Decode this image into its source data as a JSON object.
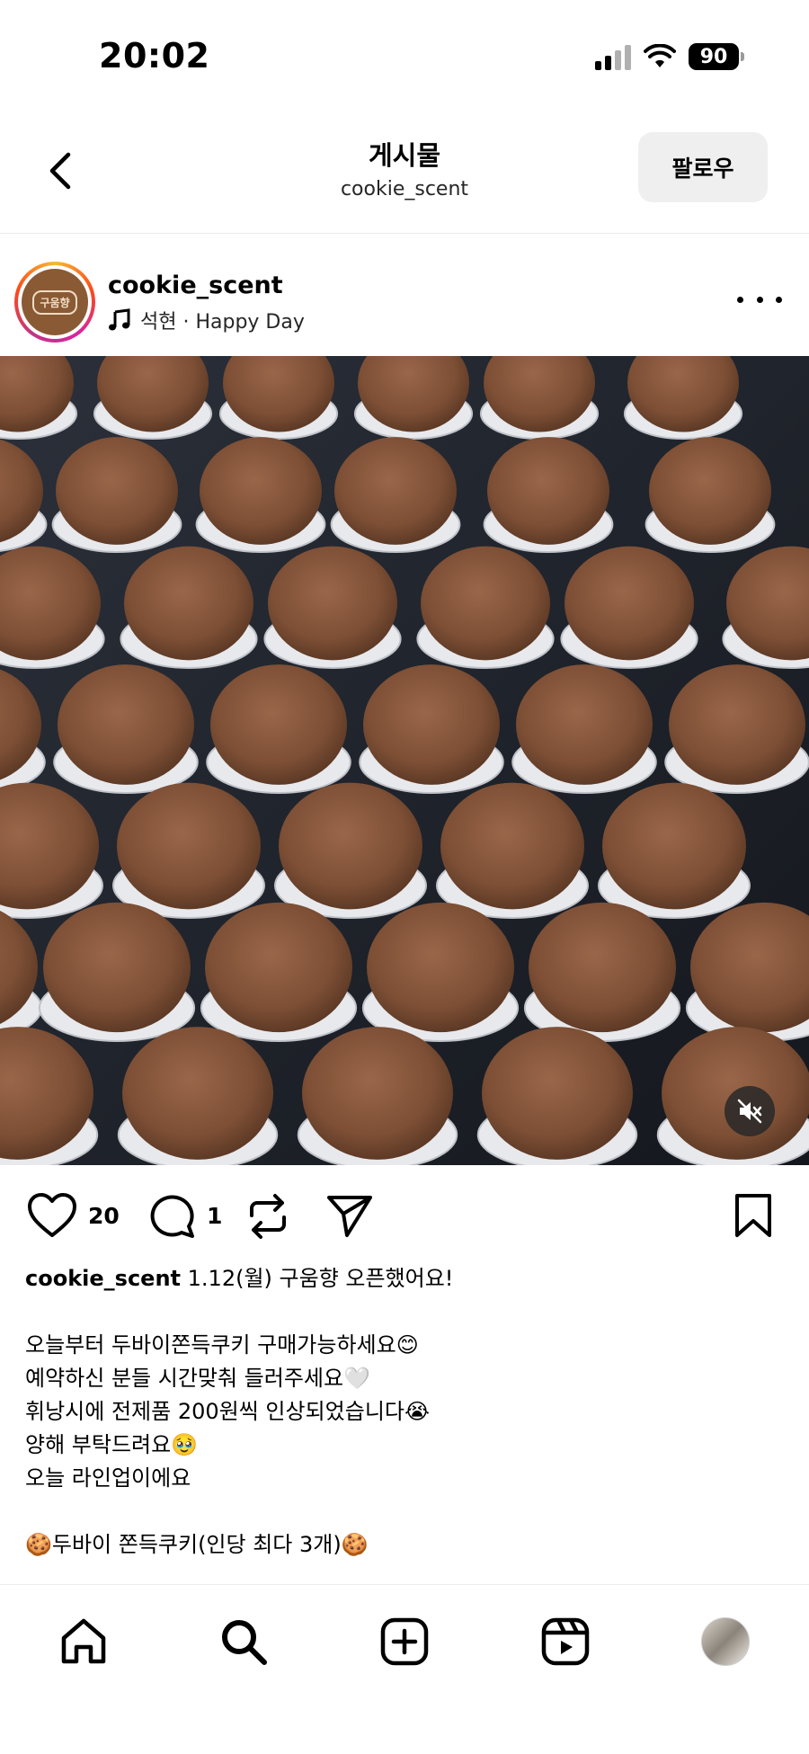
{
  "status_bar": {
    "time": "20:02",
    "battery": "90"
  },
  "header": {
    "title": "게시물",
    "subtitle": "cookie_scent",
    "follow_label": "팔로우"
  },
  "post": {
    "username": "cookie_scent",
    "avatar_text": "구움향",
    "music": "석현 · Happy Day",
    "likes": "20",
    "comments": "1"
  },
  "caption": {
    "username": "cookie_scent",
    "first_line": "1.12(월) 구움향 오픈했어요!",
    "lines": [
      "",
      "오늘부터 두바이쫀득쿠키 구매가능하세요😊",
      "예약하신 분들 시간맞춰 들러주세요🤍",
      "휘낭시에 전제품 200원씩 인상되었습니다😭",
      "양해 부탁드려요🥹",
      "오늘 라인업이에요",
      "",
      "🍪두바이 쫀득쿠키(인당 최다 3개)🍪"
    ]
  },
  "icons": {
    "back": "chevron-left-icon",
    "more": "more-horizontal-icon",
    "music": "music-note-icon",
    "like": "heart-icon",
    "comment": "comment-icon",
    "repost": "repost-icon",
    "share": "send-icon",
    "save": "bookmark-icon",
    "mute": "speaker-muted-icon",
    "home": "home-icon",
    "search": "search-icon",
    "create": "plus-square-icon",
    "reels": "reels-icon",
    "profile": "profile-avatar"
  },
  "colors": {
    "text": "#000000",
    "follow_bg": "#efefef",
    "cookie": "#8b5a3c",
    "tray": "#1f232b"
  }
}
